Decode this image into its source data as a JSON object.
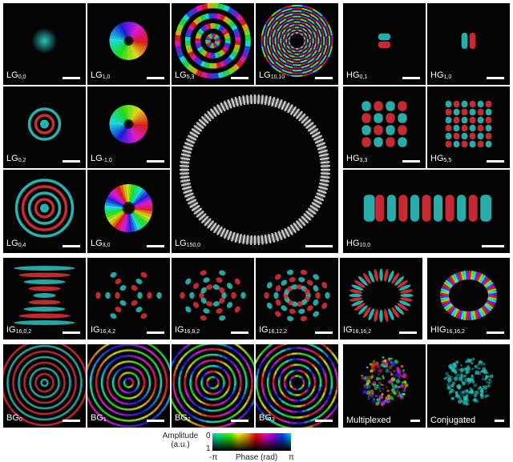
{
  "panels": [
    {
      "id": "lg00",
      "label": "LG",
      "sub": "0,0",
      "kind": "spot"
    },
    {
      "id": "lg10",
      "label": "LG",
      "sub": "1,0",
      "kind": "vortex",
      "l": 1
    },
    {
      "id": "lg53",
      "label": "LG",
      "sub": "5,3",
      "kind": "lgring",
      "l": 5,
      "rings": 4
    },
    {
      "id": "lg1010",
      "label": "LG",
      "sub": "10,10",
      "kind": "lgring",
      "l": 10,
      "rings": 11
    },
    {
      "id": "hg01",
      "label": "HG",
      "sub": "0,1",
      "kind": "hg",
      "m": 0,
      "n": 1
    },
    {
      "id": "hg10",
      "label": "HG",
      "sub": "1,0",
      "kind": "hg",
      "m": 1,
      "n": 0
    },
    {
      "id": "lg02",
      "label": "LG",
      "sub": "0,2",
      "kind": "rings",
      "count": 3
    },
    {
      "id": "lgm10",
      "label": "LG",
      "sub": "-1,0",
      "kind": "vortex",
      "l": -1
    },
    {
      "id": "lg1500",
      "label": "LG",
      "sub": "150,0",
      "kind": "bigring"
    },
    {
      "id": "hg33",
      "label": "HG",
      "sub": "3,3",
      "kind": "hg",
      "m": 3,
      "n": 3
    },
    {
      "id": "hg55",
      "label": "HG",
      "sub": "5,5",
      "kind": "hg",
      "m": 5,
      "n": 5
    },
    {
      "id": "lg04",
      "label": "LG",
      "sub": "0,4",
      "kind": "rings",
      "count": 5
    },
    {
      "id": "lg30",
      "label": "LG",
      "sub": "3,0",
      "kind": "vortex",
      "l": 3
    },
    {
      "id": "hg100",
      "label": "HG",
      "sub": "10,0",
      "kind": "hg",
      "m": 10,
      "n": 0
    },
    {
      "id": "ig1602",
      "label": "IG",
      "sub": "16,0,2",
      "kind": "ig",
      "petals": 2
    },
    {
      "id": "ig1642",
      "label": "IG",
      "sub": "16,4,2",
      "kind": "ig",
      "petals": 6
    },
    {
      "id": "ig1682",
      "label": "IG",
      "sub": "16,8,2",
      "kind": "ig",
      "petals": 10
    },
    {
      "id": "ig16122",
      "label": "IG",
      "sub": "16,12,2",
      "kind": "ig",
      "petals": 14
    },
    {
      "id": "ig16162",
      "label": "IG",
      "sub": "16,16,2",
      "kind": "petalring",
      "petals": 32
    },
    {
      "id": "hig16162",
      "label": "HIG",
      "sub": "16,16,2",
      "kind": "hig"
    },
    {
      "id": "bg0",
      "label": "BG",
      "sub": "0",
      "kind": "bessel",
      "l": 0
    },
    {
      "id": "bg1",
      "label": "BG",
      "sub": "1",
      "kind": "bessel",
      "l": 1
    },
    {
      "id": "bg2",
      "label": "BG",
      "sub": "2",
      "kind": "bessel",
      "l": 2
    },
    {
      "id": "bg3",
      "label": "BG",
      "sub": "3",
      "kind": "bessel",
      "l": 3
    },
    {
      "id": "multiplexed",
      "label": "Multiplexed",
      "sub": "",
      "kind": "speckle"
    },
    {
      "id": "conjugated",
      "label": "Conjugated",
      "sub": "",
      "kind": "speckle-cyan"
    }
  ],
  "colorbar": {
    "amplitude_label_line1": "Amplitude",
    "amplitude_label_line2": "(a.u.)",
    "amp_max": "1",
    "amp_min": "0",
    "phase_label": "Phase (rad)",
    "phase_min": "-π",
    "phase_max": "π"
  },
  "colors": {
    "phase_positive": "#e0303a",
    "phase_negative": "#2cc4c0",
    "background": "#040404",
    "frame": "#ffffff"
  }
}
